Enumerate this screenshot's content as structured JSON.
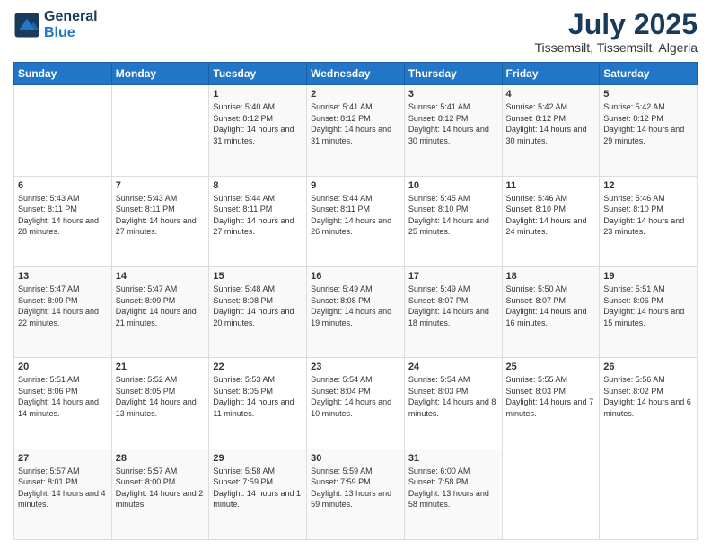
{
  "logo": {
    "line1": "General",
    "line2": "Blue"
  },
  "title": "July 2025",
  "location": "Tissemsilt, Tissemsilt, Algeria",
  "weekdays": [
    "Sunday",
    "Monday",
    "Tuesday",
    "Wednesday",
    "Thursday",
    "Friday",
    "Saturday"
  ],
  "weeks": [
    [
      {
        "day": "",
        "sunrise": "",
        "sunset": "",
        "daylight": ""
      },
      {
        "day": "",
        "sunrise": "",
        "sunset": "",
        "daylight": ""
      },
      {
        "day": "1",
        "sunrise": "Sunrise: 5:40 AM",
        "sunset": "Sunset: 8:12 PM",
        "daylight": "Daylight: 14 hours and 31 minutes."
      },
      {
        "day": "2",
        "sunrise": "Sunrise: 5:41 AM",
        "sunset": "Sunset: 8:12 PM",
        "daylight": "Daylight: 14 hours and 31 minutes."
      },
      {
        "day": "3",
        "sunrise": "Sunrise: 5:41 AM",
        "sunset": "Sunset: 8:12 PM",
        "daylight": "Daylight: 14 hours and 30 minutes."
      },
      {
        "day": "4",
        "sunrise": "Sunrise: 5:42 AM",
        "sunset": "Sunset: 8:12 PM",
        "daylight": "Daylight: 14 hours and 30 minutes."
      },
      {
        "day": "5",
        "sunrise": "Sunrise: 5:42 AM",
        "sunset": "Sunset: 8:12 PM",
        "daylight": "Daylight: 14 hours and 29 minutes."
      }
    ],
    [
      {
        "day": "6",
        "sunrise": "Sunrise: 5:43 AM",
        "sunset": "Sunset: 8:11 PM",
        "daylight": "Daylight: 14 hours and 28 minutes."
      },
      {
        "day": "7",
        "sunrise": "Sunrise: 5:43 AM",
        "sunset": "Sunset: 8:11 PM",
        "daylight": "Daylight: 14 hours and 27 minutes."
      },
      {
        "day": "8",
        "sunrise": "Sunrise: 5:44 AM",
        "sunset": "Sunset: 8:11 PM",
        "daylight": "Daylight: 14 hours and 27 minutes."
      },
      {
        "day": "9",
        "sunrise": "Sunrise: 5:44 AM",
        "sunset": "Sunset: 8:11 PM",
        "daylight": "Daylight: 14 hours and 26 minutes."
      },
      {
        "day": "10",
        "sunrise": "Sunrise: 5:45 AM",
        "sunset": "Sunset: 8:10 PM",
        "daylight": "Daylight: 14 hours and 25 minutes."
      },
      {
        "day": "11",
        "sunrise": "Sunrise: 5:46 AM",
        "sunset": "Sunset: 8:10 PM",
        "daylight": "Daylight: 14 hours and 24 minutes."
      },
      {
        "day": "12",
        "sunrise": "Sunrise: 5:46 AM",
        "sunset": "Sunset: 8:10 PM",
        "daylight": "Daylight: 14 hours and 23 minutes."
      }
    ],
    [
      {
        "day": "13",
        "sunrise": "Sunrise: 5:47 AM",
        "sunset": "Sunset: 8:09 PM",
        "daylight": "Daylight: 14 hours and 22 minutes."
      },
      {
        "day": "14",
        "sunrise": "Sunrise: 5:47 AM",
        "sunset": "Sunset: 8:09 PM",
        "daylight": "Daylight: 14 hours and 21 minutes."
      },
      {
        "day": "15",
        "sunrise": "Sunrise: 5:48 AM",
        "sunset": "Sunset: 8:08 PM",
        "daylight": "Daylight: 14 hours and 20 minutes."
      },
      {
        "day": "16",
        "sunrise": "Sunrise: 5:49 AM",
        "sunset": "Sunset: 8:08 PM",
        "daylight": "Daylight: 14 hours and 19 minutes."
      },
      {
        "day": "17",
        "sunrise": "Sunrise: 5:49 AM",
        "sunset": "Sunset: 8:07 PM",
        "daylight": "Daylight: 14 hours and 18 minutes."
      },
      {
        "day": "18",
        "sunrise": "Sunrise: 5:50 AM",
        "sunset": "Sunset: 8:07 PM",
        "daylight": "Daylight: 14 hours and 16 minutes."
      },
      {
        "day": "19",
        "sunrise": "Sunrise: 5:51 AM",
        "sunset": "Sunset: 8:06 PM",
        "daylight": "Daylight: 14 hours and 15 minutes."
      }
    ],
    [
      {
        "day": "20",
        "sunrise": "Sunrise: 5:51 AM",
        "sunset": "Sunset: 8:06 PM",
        "daylight": "Daylight: 14 hours and 14 minutes."
      },
      {
        "day": "21",
        "sunrise": "Sunrise: 5:52 AM",
        "sunset": "Sunset: 8:05 PM",
        "daylight": "Daylight: 14 hours and 13 minutes."
      },
      {
        "day": "22",
        "sunrise": "Sunrise: 5:53 AM",
        "sunset": "Sunset: 8:05 PM",
        "daylight": "Daylight: 14 hours and 11 minutes."
      },
      {
        "day": "23",
        "sunrise": "Sunrise: 5:54 AM",
        "sunset": "Sunset: 8:04 PM",
        "daylight": "Daylight: 14 hours and 10 minutes."
      },
      {
        "day": "24",
        "sunrise": "Sunrise: 5:54 AM",
        "sunset": "Sunset: 8:03 PM",
        "daylight": "Daylight: 14 hours and 8 minutes."
      },
      {
        "day": "25",
        "sunrise": "Sunrise: 5:55 AM",
        "sunset": "Sunset: 8:03 PM",
        "daylight": "Daylight: 14 hours and 7 minutes."
      },
      {
        "day": "26",
        "sunrise": "Sunrise: 5:56 AM",
        "sunset": "Sunset: 8:02 PM",
        "daylight": "Daylight: 14 hours and 6 minutes."
      }
    ],
    [
      {
        "day": "27",
        "sunrise": "Sunrise: 5:57 AM",
        "sunset": "Sunset: 8:01 PM",
        "daylight": "Daylight: 14 hours and 4 minutes."
      },
      {
        "day": "28",
        "sunrise": "Sunrise: 5:57 AM",
        "sunset": "Sunset: 8:00 PM",
        "daylight": "Daylight: 14 hours and 2 minutes."
      },
      {
        "day": "29",
        "sunrise": "Sunrise: 5:58 AM",
        "sunset": "Sunset: 7:59 PM",
        "daylight": "Daylight: 14 hours and 1 minute."
      },
      {
        "day": "30",
        "sunrise": "Sunrise: 5:59 AM",
        "sunset": "Sunset: 7:59 PM",
        "daylight": "Daylight: 13 hours and 59 minutes."
      },
      {
        "day": "31",
        "sunrise": "Sunrise: 6:00 AM",
        "sunset": "Sunset: 7:58 PM",
        "daylight": "Daylight: 13 hours and 58 minutes."
      },
      {
        "day": "",
        "sunrise": "",
        "sunset": "",
        "daylight": ""
      },
      {
        "day": "",
        "sunrise": "",
        "sunset": "",
        "daylight": ""
      }
    ]
  ]
}
